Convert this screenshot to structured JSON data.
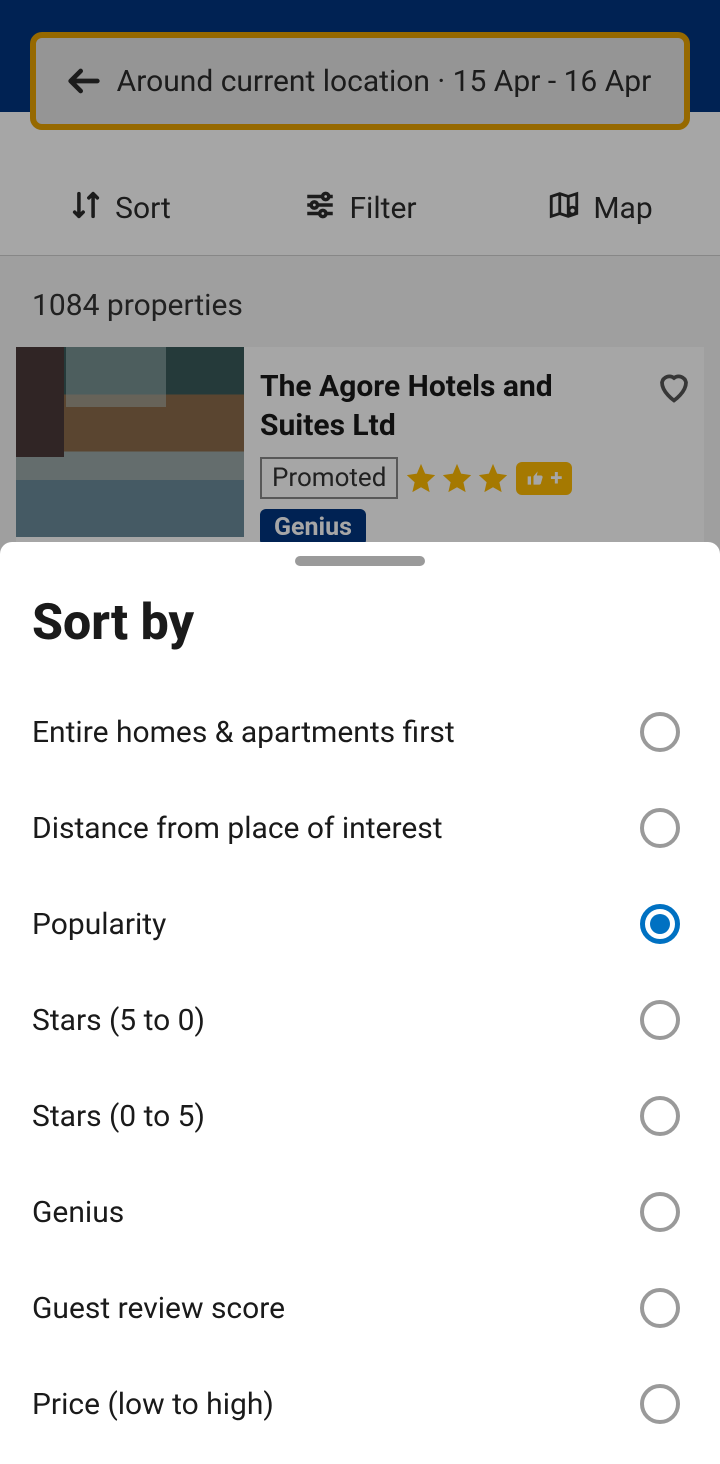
{
  "header": {
    "search_text": "Around current location · 15 Apr - 16 Apr"
  },
  "toolbar": {
    "sort_label": "Sort",
    "filter_label": "Filter",
    "map_label": "Map"
  },
  "results": {
    "count_text": "1084 properties"
  },
  "property": {
    "name": "The Agore Hotels and Suites Ltd",
    "promoted_label": "Promoted",
    "genius_label": "Genius",
    "stars": 3,
    "thumbs_plus": "+"
  },
  "sheet": {
    "title": "Sort by",
    "selected_index": 2,
    "options": [
      {
        "label": "Entire homes & apartments first"
      },
      {
        "label": "Distance from place of interest"
      },
      {
        "label": "Popularity"
      },
      {
        "label": "Stars (5 to 0)"
      },
      {
        "label": "Stars (0 to 5)"
      },
      {
        "label": "Genius"
      },
      {
        "label": "Guest review score"
      },
      {
        "label": "Price (low to high)"
      }
    ]
  }
}
